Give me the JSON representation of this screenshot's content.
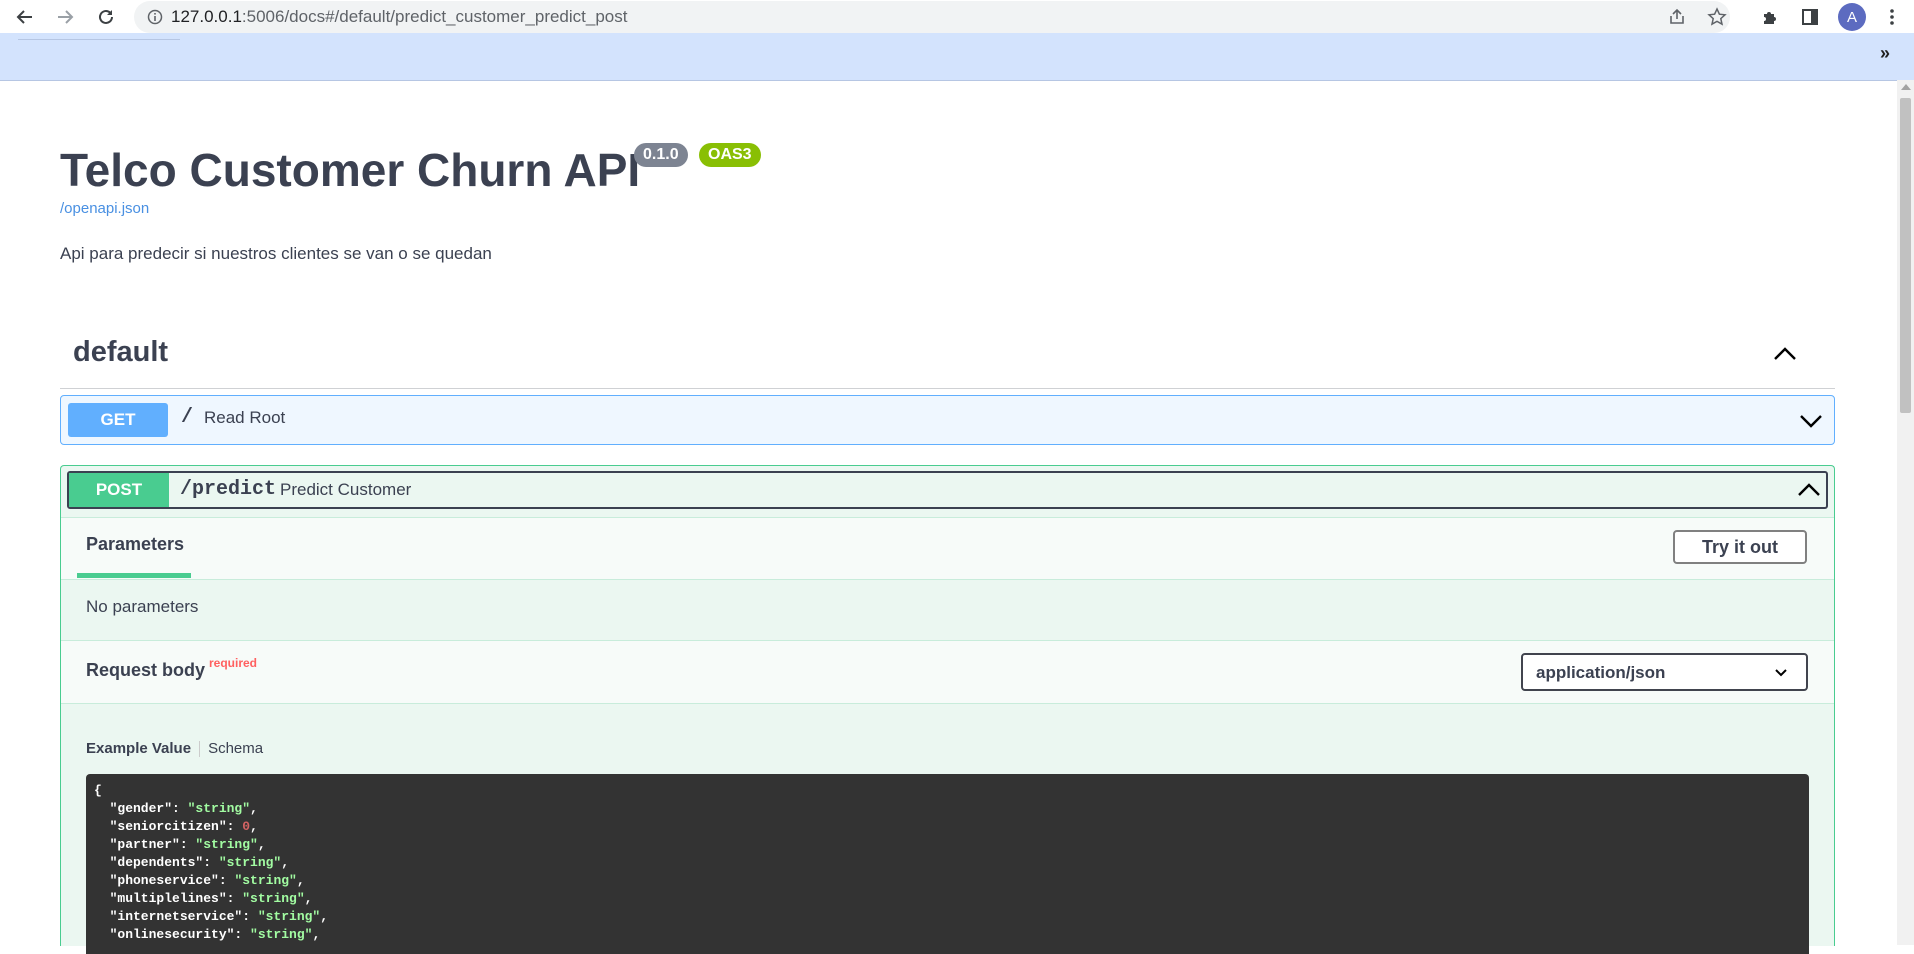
{
  "browser": {
    "url_host": "127.0.0.1",
    "url_rest": ":5006/docs#/default/predict_customer_predict_post",
    "avatar_letter": "A",
    "bookmarks_more": "»"
  },
  "info": {
    "title": "Telco Customer Churn API",
    "version": "0.1.0",
    "oas_badge": "OAS3",
    "spec_link": "/openapi.json",
    "description": "Api para predecir si nuestros clientes se van o se quedan"
  },
  "tag": {
    "name": "default"
  },
  "operations": {
    "get": {
      "method": "GET",
      "path": "/",
      "summary": "Read Root"
    },
    "post": {
      "method": "POST",
      "path": "/predict",
      "summary": "Predict Customer",
      "parameters_tab": "Parameters",
      "try_button": "Try it out",
      "no_parameters": "No parameters",
      "request_body_title": "Request body",
      "required_label": "required",
      "content_type": "application/json",
      "example_tab": "Example Value",
      "schema_tab": "Schema",
      "example_lines": [
        {
          "open": "{"
        },
        {
          "key": "\"gender\"",
          "value": "\"string\"",
          "type": "str"
        },
        {
          "key": "\"seniorcitizen\"",
          "value": "0",
          "type": "num"
        },
        {
          "key": "\"partner\"",
          "value": "\"string\"",
          "type": "str"
        },
        {
          "key": "\"dependents\"",
          "value": "\"string\"",
          "type": "str"
        },
        {
          "key": "\"phoneservice\"",
          "value": "\"string\"",
          "type": "str"
        },
        {
          "key": "\"multiplelines\"",
          "value": "\"string\"",
          "type": "str"
        },
        {
          "key": "\"internetservice\"",
          "value": "\"string\"",
          "type": "str"
        },
        {
          "key": "\"onlinesecurity\"",
          "value": "\"string\"",
          "type": "str"
        }
      ]
    }
  },
  "colors": {
    "get": "#61affe",
    "post": "#49cc90",
    "badge_version": "#7d8492",
    "badge_oas": "#89bf04",
    "link": "#4990e2",
    "required": "#ff6060"
  }
}
